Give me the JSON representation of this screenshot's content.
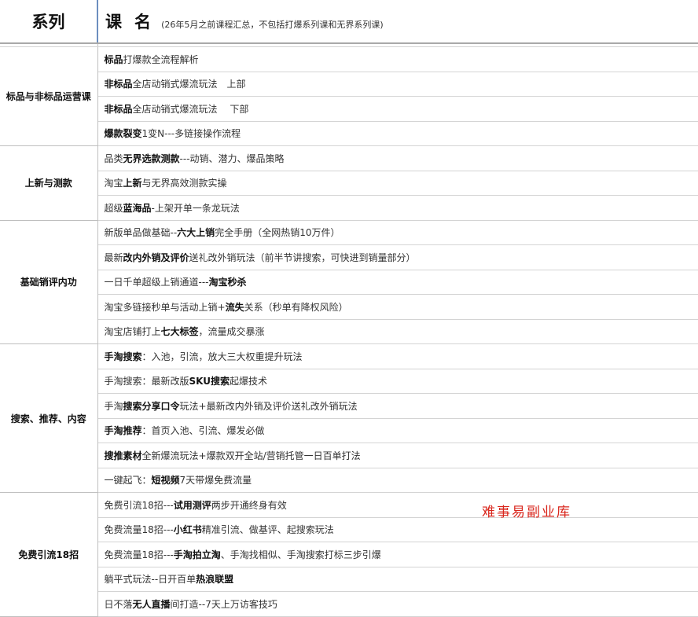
{
  "header": {
    "series_label": "系列",
    "course_label": "课名",
    "note": "(26年5月之前课程汇总，不包括打爆系列课和无界系列课)"
  },
  "groups": [
    {
      "name": "标品与非标品运营课",
      "courses": [
        {
          "bold": "标品",
          "text": "打爆款全流程解析"
        },
        {
          "bold": "非标品",
          "text": "全店动销式爆流玩法　上部"
        },
        {
          "bold": "非标品",
          "text": "全店动销式爆流玩法　 下部"
        },
        {
          "bold": "爆款裂变",
          "text": "1变N---多链接操作流程"
        }
      ]
    },
    {
      "name": "上新与测款",
      "courses": [
        {
          "pre": "品类",
          "bold": "无界选款测款",
          "text": "---动销、潜力、爆品策略"
        },
        {
          "pre": "淘宝",
          "bold": "上新",
          "text": "与无界高效测款实操"
        },
        {
          "pre": "超级",
          "bold": "蓝海品",
          "text": "-上架开单一条龙玩法"
        }
      ]
    },
    {
      "name": "基础销评内功",
      "courses": [
        {
          "pre": "新版单品做基础--",
          "bold": "六大上销",
          "text": "完全手册（全网热销10万件）"
        },
        {
          "pre": "最新",
          "bold": "改内外销及评价",
          "text": "送礼改外销玩法（前半节讲搜索，可快进到销量部分）"
        },
        {
          "pre": "一日千单超级上销通道---",
          "bold": "淘宝秒杀",
          "text": ""
        },
        {
          "pre": "淘宝多链接秒单与活动上销+",
          "bold": "流失",
          "text": "关系（秒单有降权风险）"
        },
        {
          "pre": "淘宝店铺打上",
          "bold": "七大标签",
          "text": "，流量成交暴涨"
        }
      ]
    },
    {
      "name": "搜索、推荐、内容",
      "courses": [
        {
          "bold": "手淘搜索",
          "text": "：入池，引流，放大三大权重提升玩法"
        },
        {
          "pre": "手淘搜索：最新改版",
          "bold": "SKU搜索",
          "text": "起爆技术"
        },
        {
          "pre": "手淘",
          "bold": "搜索分享口令",
          "text": "玩法+最新改内外销及评价送礼改外销玩法"
        },
        {
          "bold": "手淘推荐",
          "text": "：首页入池、引流、爆发必做"
        },
        {
          "bold": "搜推素材",
          "text": "全新爆流玩法+爆款双开全站/营销托管一日百单打法"
        },
        {
          "pre": "一键起飞：",
          "bold": "短视频",
          "text": "7天带爆免费流量"
        }
      ]
    },
    {
      "name": "免费引流18招",
      "courses": [
        {
          "pre": "免费引流18招---",
          "bold": "试用测评",
          "text": "两步开通终身有效"
        },
        {
          "pre": "免费流量18招---",
          "bold": "小红书",
          "text": "精准引流、做基评、起搜索玩法"
        },
        {
          "pre": "免费流量18招---",
          "bold": "手淘拍立淘",
          "text": "、手淘找相似、手淘搜索打标三步引爆"
        },
        {
          "pre": "躺平式玩法--日开百单",
          "bold": "热浪联盟",
          "text": ""
        },
        {
          "pre": "日不落",
          "bold": "无人直播",
          "text": "间打造--7天上万访客技巧"
        }
      ]
    }
  ],
  "watermark": "难事易副业库"
}
